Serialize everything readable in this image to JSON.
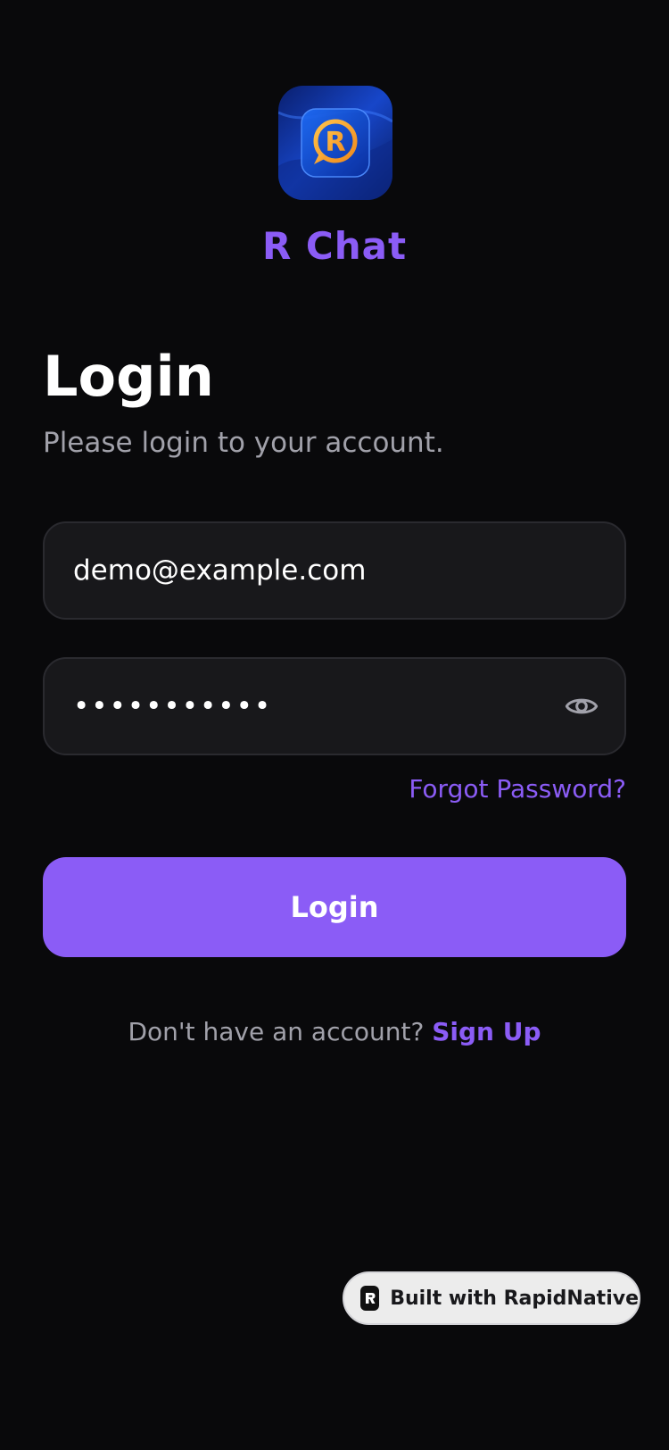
{
  "app": {
    "name": "R Chat",
    "logo_icon": "chat-bubble-r-logo",
    "brand_color": "#8b5cf6"
  },
  "header": {
    "title": "Login",
    "subtitle": "Please login to your account."
  },
  "form": {
    "email_value": "demo@example.com",
    "password_value": "•••••••••••",
    "password_toggle_icon": "eye-icon",
    "forgot_label": "Forgot Password?",
    "submit_label": "Login"
  },
  "signup": {
    "prompt": "Don't have an account?",
    "link_label": "Sign Up"
  },
  "badge": {
    "label": "Built with RapidNative",
    "icon": "rapidnative-logo-icon"
  },
  "colors": {
    "background": "#09090b",
    "field_background": "#18181b",
    "muted_text": "#a1a1aa",
    "accent": "#8b5cf6"
  }
}
